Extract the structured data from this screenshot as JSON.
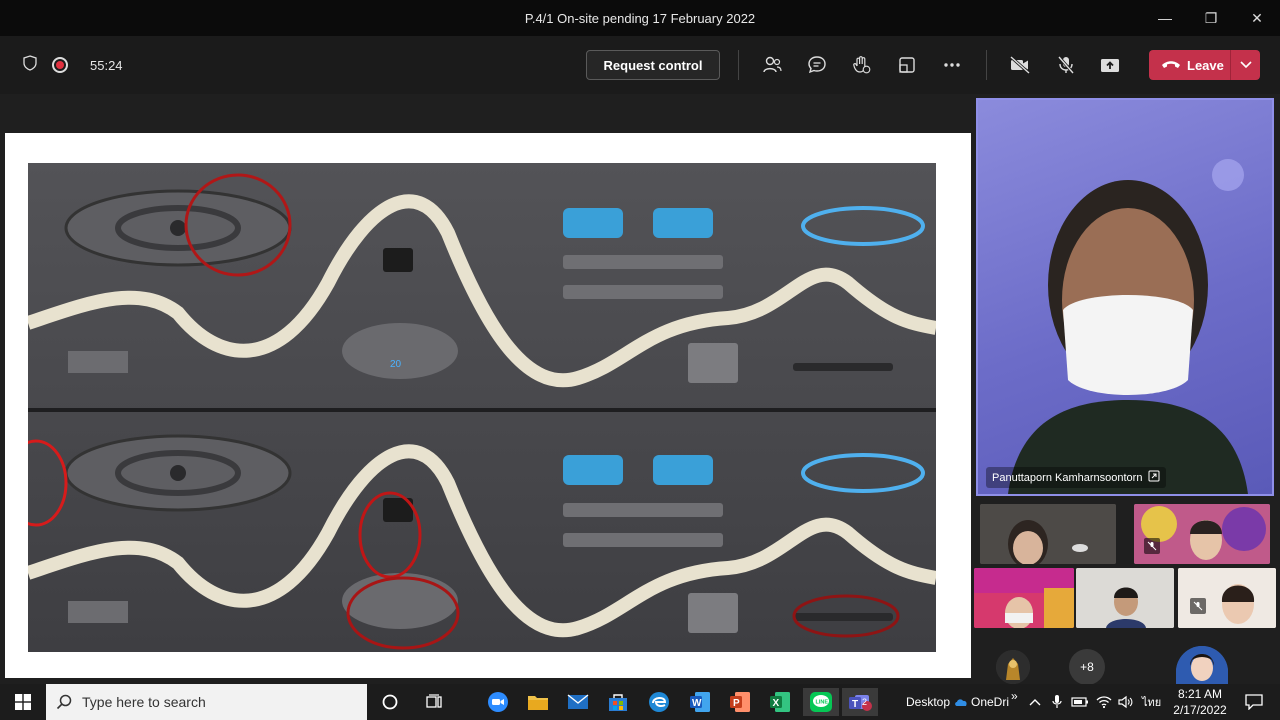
{
  "window": {
    "title": "P.4/1 On-site pending 17 February 2022",
    "minimize_glyph": "—",
    "maximize_glyph": "❐",
    "close_glyph": "✕"
  },
  "toolbar": {
    "timer": "55:24",
    "request_control_label": "Request control",
    "leave_label": "Leave",
    "icons": [
      "shield-icon",
      "record-icon",
      "people-icon",
      "chat-icon",
      "reactions-icon",
      "rooms-icon",
      "more-icon",
      "camera-off-icon",
      "mic-off-icon",
      "share-icon",
      "phone-icon",
      "chevron-down-icon"
    ],
    "accent": "#c4314b"
  },
  "participants": {
    "speaker_name": "Panuttaporn Kamharnsoontorn",
    "more_count": "+8"
  },
  "taskbar": {
    "search_placeholder": "Type here to search",
    "desktop_label": "Desktop",
    "onedrive_label": "OneDri",
    "overflow_glyph": "»",
    "lang": "ไทย",
    "time": "8:21 AM",
    "date": "2/17/2022",
    "app_icons": [
      "zoom-icon",
      "file-explorer-icon",
      "mail-icon",
      "store-icon",
      "edge-icon",
      "word-icon",
      "powerpoint-icon",
      "excel-icon",
      "line-icon",
      "teams-icon"
    ],
    "teams_badge": "2"
  }
}
